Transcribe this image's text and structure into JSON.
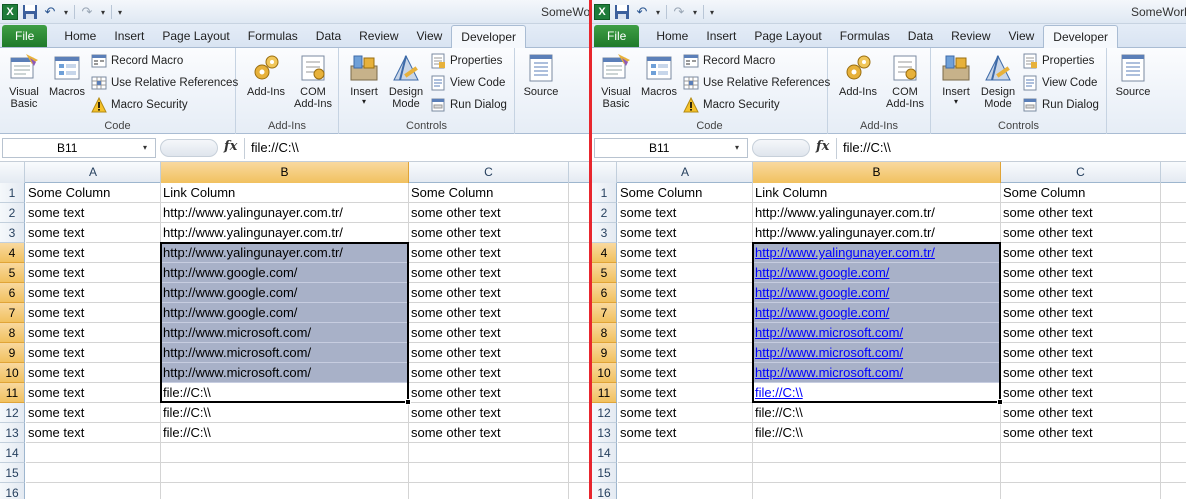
{
  "window": {
    "title": "SomeWork"
  },
  "quick_access": {
    "app_icon": "excel-icon",
    "save_icon": "save-icon",
    "undo_icon": "undo-icon",
    "redo_icon": "redo-icon",
    "customize_icon": "customize-qat-icon",
    "app_icon_glyph": "X",
    "save_glyph": "💾",
    "undo_glyph": "↶",
    "redo_glyph": "↷",
    "arrow_glyph": "▾",
    "customize_glyph": "⌄"
  },
  "tabs": [
    {
      "label": "File",
      "kind": "file"
    },
    {
      "label": "Home"
    },
    {
      "label": "Insert"
    },
    {
      "label": "Page Layout"
    },
    {
      "label": "Formulas"
    },
    {
      "label": "Data"
    },
    {
      "label": "Review"
    },
    {
      "label": "View"
    },
    {
      "label": "Developer",
      "active": true
    }
  ],
  "ribbon": {
    "code": {
      "label": "Code",
      "visual_basic": "Visual\nBasic",
      "macros": "Macros",
      "record_macro": "Record Macro",
      "relative_refs": "Use Relative References",
      "macro_security": "Macro Security"
    },
    "addins": {
      "label": "Add-Ins",
      "add_ins": "Add-Ins",
      "com_add_ins": "COM\nAdd-Ins"
    },
    "controls": {
      "label": "Controls",
      "insert": "Insert",
      "design_mode": "Design\nMode",
      "properties": "Properties",
      "view_code": "View Code",
      "run_dialog": "Run Dialog"
    },
    "xml": {
      "source": "Source"
    }
  },
  "formula_bar": {
    "name_box": "B11",
    "fx": "fx",
    "value": "file://C:\\\\",
    "namebox_arrow": "▾"
  },
  "columns": [
    "A",
    "B",
    "C"
  ],
  "row_numbers": [
    "1",
    "2",
    "3",
    "4",
    "5",
    "6",
    "7",
    "8",
    "9",
    "10",
    "11",
    "12",
    "13",
    "14",
    "15",
    "16"
  ],
  "panes": {
    "left": {
      "rows": [
        [
          "Some Column",
          "Link Column",
          "Some Column"
        ],
        [
          "some text",
          "http://www.yalingunayer.com.tr/",
          "some other text"
        ],
        [
          "some text",
          "http://www.yalingunayer.com.tr/",
          "some other text"
        ],
        [
          "some text",
          "http://www.yalingunayer.com.tr/",
          "some other text"
        ],
        [
          "some text",
          "http://www.google.com/",
          "some other text"
        ],
        [
          "some text",
          "http://www.google.com/",
          "some other text"
        ],
        [
          "some text",
          "http://www.google.com/",
          "some other text"
        ],
        [
          "some text",
          "http://www.microsoft.com/",
          "some other text"
        ],
        [
          "some text",
          "http://www.microsoft.com/",
          "some other text"
        ],
        [
          "some text",
          "http://www.microsoft.com/",
          "some other text"
        ],
        [
          "some text",
          "file://C:\\\\",
          "some other text"
        ],
        [
          "some text",
          "file://C:\\\\",
          "some other text"
        ],
        [
          "some text",
          "file://C:\\\\",
          "some other text"
        ],
        [
          "",
          "",
          ""
        ],
        [
          "",
          "",
          ""
        ],
        [
          "",
          "",
          ""
        ]
      ]
    },
    "right": {
      "rows": [
        [
          "Some Column",
          "Link Column",
          "Some Column"
        ],
        [
          "some text",
          "http://www.yalingunayer.com.tr/",
          "some other text"
        ],
        [
          "some text",
          "http://www.yalingunayer.com.tr/",
          "some other text"
        ],
        [
          "some text",
          "http://www.yalingunayer.com.tr/",
          "some other text"
        ],
        [
          "some text",
          "http://www.google.com/",
          "some other text"
        ],
        [
          "some text",
          "http://www.google.com/",
          "some other text"
        ],
        [
          "some text",
          "http://www.google.com/",
          "some other text"
        ],
        [
          "some text",
          "http://www.microsoft.com/",
          "some other text"
        ],
        [
          "some text",
          "http://www.microsoft.com/",
          "some other text"
        ],
        [
          "some text",
          "http://www.microsoft.com/",
          "some other text"
        ],
        [
          "some text",
          "file://C:\\\\",
          "some other text"
        ],
        [
          "some text",
          "file://C:\\\\",
          "some other text"
        ],
        [
          "some text",
          "file://C:\\\\",
          "some other text"
        ],
        [
          "",
          "",
          ""
        ],
        [
          "",
          "",
          ""
        ],
        [
          "",
          "",
          ""
        ]
      ]
    }
  },
  "selection": {
    "column": "B",
    "first_row": 4,
    "last_row": 11,
    "active_cell": "B11"
  },
  "colors": {
    "selection_fill": "#a8b1c8",
    "hyperlink": "#0000ff",
    "file_tab": "#2a8a35",
    "divider": "#e8262d"
  }
}
